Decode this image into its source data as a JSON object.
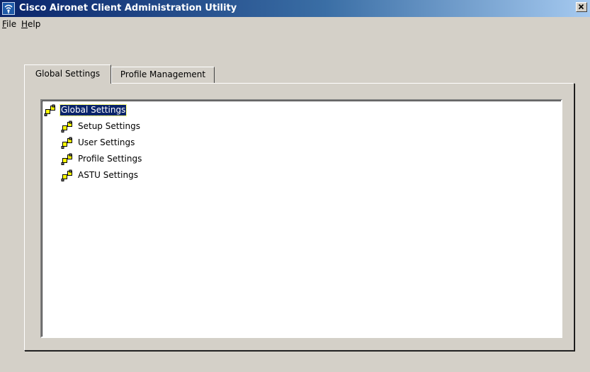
{
  "window": {
    "title": "Cisco Aironet Client Administration Utility",
    "close_label": "×"
  },
  "menu": [
    {
      "accel": "F",
      "rest": "ile"
    },
    {
      "accel": "H",
      "rest": "elp"
    }
  ],
  "tabs": [
    {
      "label": "Global Settings",
      "active": true
    },
    {
      "label": "Profile Management",
      "active": false
    }
  ],
  "tree": {
    "root": {
      "label": "Global Settings",
      "selected": true
    },
    "children": [
      {
        "label": "Setup Settings"
      },
      {
        "label": "User Settings"
      },
      {
        "label": "Profile Settings"
      },
      {
        "label": "ASTU Settings"
      }
    ]
  },
  "colors": {
    "titlebar_start": "#0a246a",
    "titlebar_end": "#a6caf0",
    "face": "#d4d0c8",
    "selection": "#0a246a",
    "icon_yellow": "#ffff00"
  }
}
